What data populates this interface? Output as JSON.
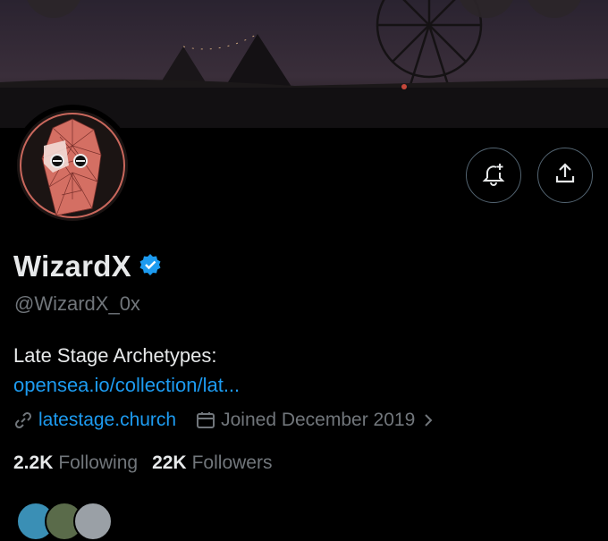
{
  "profile": {
    "name": "WizardX",
    "handle": "@WizardX_0x",
    "bio_text": "Late Stage Archetypes:",
    "bio_link": "opensea.io/collection/lat...",
    "website": "latestage.church",
    "joined": "Joined December 2019",
    "following_count": "2.2K",
    "following_label": "Following",
    "followers_count": "22K",
    "followers_label": "Followers"
  },
  "icons": {
    "verified": "verified-badge-icon",
    "notify": "bell-plus-icon",
    "share": "share-icon",
    "link": "link-icon",
    "calendar": "calendar-icon",
    "chevron": "chevron-right-icon"
  },
  "colors": {
    "background": "#000000",
    "text": "#e7e9ea",
    "secondary": "#71767b",
    "link": "#1d9bf0",
    "verified": "#1d9bf0",
    "avatar_accent": "#e07a6e"
  }
}
